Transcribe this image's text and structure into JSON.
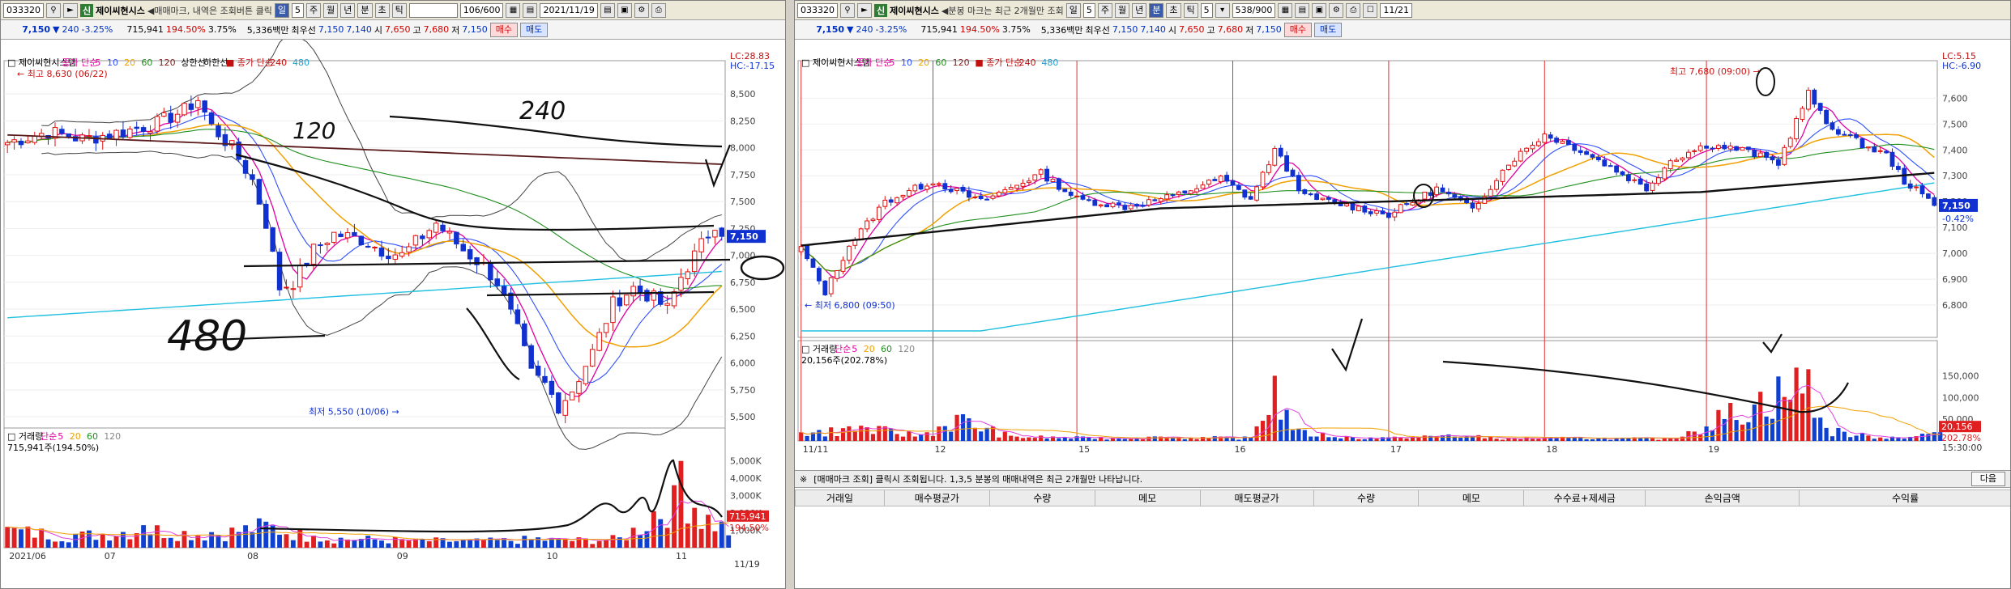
{
  "panel_left": {
    "toolbar": {
      "code": "033320",
      "badge": "신",
      "name": "제이씨현시스",
      "hint": "◀매매마크, 내역은 조회버튼 클릭",
      "period_d": "일",
      "period_num": "5",
      "periods": [
        "주",
        "월",
        "년",
        "분",
        "초",
        "틱"
      ],
      "count": "106/600",
      "date": "2021/11/19"
    },
    "quote": {
      "price": "7,150",
      "change_dir": "▼",
      "change": "240",
      "pct": "-3.25%",
      "volume": "715,941",
      "vol_ratio": "194.50%",
      "turnover": "3.75%",
      "amount": "5,336백만",
      "prev_label": "최우선",
      "bid": "7,150",
      "ask": "7,140",
      "open_l": "시",
      "open": "7,650",
      "high_l": "고",
      "high": "7,680",
      "low_l": "저",
      "low": "7,150",
      "buy": "매수",
      "sell": "매도"
    },
    "legend": {
      "name": "제이씨현시스템",
      "ma_label": "종가 단순",
      "p5": "5",
      "p10": "10",
      "p20": "20",
      "p60": "60",
      "p120": "120",
      "upper": "상한선",
      "lower": "하한선",
      "ma2_label": "종가 단순",
      "p240": "240",
      "p480": "480"
    },
    "corner": {
      "lc": "LC:28.83",
      "hc": "HC:-17.15"
    },
    "annot_high": "← 최고 8,630 (06/22)",
    "annot_low": "최저 5,550 (10/06) →",
    "hand": {
      "h240": "240",
      "h120": "120",
      "h480": "480"
    },
    "vol_legend": {
      "label": "거래량",
      "ma": "단순",
      "p5": "5",
      "p20": "20",
      "p60": "60",
      "p120": "120",
      "value": "715,941주(194.50%)"
    },
    "vol_tags": {
      "v": "715,941",
      "pct": "194.50%"
    },
    "price_tag": "7,150",
    "date_label": "11/19"
  },
  "panel_right": {
    "toolbar": {
      "code": "033320",
      "badge": "신",
      "name": "제이씨현시스",
      "hint": "◀분봉 마크는 최근 2개월만 조회",
      "period_d": "일",
      "period_num": "5",
      "periods": [
        "주",
        "월",
        "년",
        "분",
        "초",
        "틱"
      ],
      "period_num2": "5",
      "count": "538/900",
      "date": "11/21"
    },
    "quote": {
      "price": "7,150",
      "change_dir": "▼",
      "change": "240",
      "pct": "-3.25%",
      "volume": "715,941",
      "vol_ratio": "194.50%",
      "turnover": "3.75%",
      "amount": "5,336백만",
      "prev_label": "최우선",
      "bid": "7,150",
      "ask": "7,140",
      "open_l": "시",
      "open": "7,650",
      "high_l": "고",
      "high": "7,680",
      "low_l": "저",
      "low": "7,150",
      "buy": "매수",
      "sell": "매도"
    },
    "legend": {
      "name": "제이씨현시스템",
      "ma_label": "종가 단순",
      "p5": "5",
      "p10": "10",
      "p20": "20",
      "p60": "60",
      "p120": "120",
      "ma2_label": "종가 단순",
      "p240": "240",
      "p480": "480"
    },
    "corner": {
      "lc": "LC:5.15",
      "hc": "HC:-6.90"
    },
    "annot_high": "최고 7,680 (09:00) →",
    "annot_low": "← 최저 6,800 (09:50)",
    "vol_legend": {
      "label": "거래량",
      "ma": "단순",
      "p5": "5",
      "p20": "20",
      "p60": "60",
      "p120": "120",
      "value": "20,156주(202.78%)"
    },
    "vol_tags": {
      "v": "20,156",
      "pct": "202.78%"
    },
    "price_tag": "7,150",
    "price_pct": "-0.42%",
    "time_label": "15:30:00",
    "info_mark": "※",
    "info_text": "[매매마크 조회] 클릭시 조회됩니다. 1,3,5 분봉의 매매내역은 최근 2개월만 나타납니다.",
    "next_btn": "다음",
    "table_headers": [
      "거래일",
      "매수평균가",
      "수량",
      "메모",
      "매도평균가",
      "수량",
      "메모",
      "수수료+제세금",
      "손익금액",
      "수익률"
    ]
  },
  "chart_data": [
    {
      "type": "candlestick",
      "title": "제이씨현시스템",
      "timeframe": "daily",
      "x_ticks": [
        "2021/06",
        "07",
        "08",
        "09",
        "10",
        "11"
      ],
      "price_ticks": [
        5500,
        5750,
        6000,
        6250,
        6500,
        6750,
        7000,
        7250,
        7500,
        7750,
        8000,
        8250,
        8500
      ],
      "ylim": [
        5350,
        8750
      ],
      "volume_ticks": [
        "1,000K",
        "2,000K",
        "3,000K",
        "4,000K",
        "5,000K"
      ],
      "volume_ylim": [
        0,
        5500
      ],
      "annotations": {
        "high": 8630,
        "high_date": "06/22",
        "low": 5550,
        "low_date": "10/06"
      },
      "price_anchors": [
        [
          0,
          8050
        ],
        [
          6,
          8150
        ],
        [
          11,
          8080
        ],
        [
          17,
          8150
        ],
        [
          22,
          8230
        ],
        [
          26,
          8350
        ],
        [
          28,
          8450
        ],
        [
          30,
          8200
        ],
        [
          33,
          8000
        ],
        [
          36,
          7700
        ],
        [
          38,
          7300
        ],
        [
          40,
          6700
        ],
        [
          42,
          6750
        ],
        [
          45,
          7050
        ],
        [
          48,
          7200
        ],
        [
          52,
          7150
        ],
        [
          55,
          7050
        ],
        [
          58,
          7000
        ],
        [
          63,
          7300
        ],
        [
          67,
          7050
        ],
        [
          70,
          6900
        ],
        [
          72,
          6750
        ],
        [
          75,
          6300
        ],
        [
          77,
          5900
        ],
        [
          79,
          5800
        ],
        [
          81,
          5600
        ],
        [
          83,
          5750
        ],
        [
          86,
          6100
        ],
        [
          89,
          6550
        ],
        [
          92,
          6700
        ],
        [
          95,
          6600
        ],
        [
          97,
          6500
        ],
        [
          99,
          6800
        ],
        [
          102,
          7100
        ],
        [
          104,
          7300
        ],
        [
          106,
          7150
        ]
      ],
      "volume_anchors": [
        [
          0,
          1200
        ],
        [
          10,
          800
        ],
        [
          20,
          1300
        ],
        [
          30,
          900
        ],
        [
          38,
          1500
        ],
        [
          45,
          700
        ],
        [
          60,
          500
        ],
        [
          70,
          450
        ],
        [
          78,
          600
        ],
        [
          82,
          500
        ],
        [
          90,
          600
        ],
        [
          95,
          2100
        ],
        [
          98,
          3600
        ],
        [
          99,
          5000
        ],
        [
          101,
          2300
        ],
        [
          103,
          1900
        ],
        [
          105,
          1500
        ],
        [
          106,
          716
        ]
      ],
      "series_meta": {
        "count": 106
      }
    },
    {
      "type": "candlestick",
      "title": "제이씨현시스템",
      "timeframe": "5-minute",
      "x_ticks": [
        "11/11",
        "12",
        "15",
        "16",
        "17",
        "18",
        "19"
      ],
      "price_ticks": [
        6800,
        6900,
        7000,
        7100,
        7200,
        7300,
        7400,
        7500,
        7600
      ],
      "ylim": [
        6700,
        7720
      ],
      "volume_ticks": [
        "50,000",
        "100,000",
        "150,000"
      ],
      "volume_ylim": [
        0,
        175000
      ],
      "annotations": {
        "high": 7680,
        "high_time": "09:00",
        "low": 6800,
        "low_time": "09:50"
      },
      "price_anchors": [
        [
          0,
          7020
        ],
        [
          4,
          6850
        ],
        [
          8,
          7030
        ],
        [
          14,
          7200
        ],
        [
          22,
          7280
        ],
        [
          30,
          7200
        ],
        [
          40,
          7310
        ],
        [
          46,
          7210
        ],
        [
          54,
          7180
        ],
        [
          62,
          7220
        ],
        [
          70,
          7290
        ],
        [
          75,
          7210
        ],
        [
          79,
          7400
        ],
        [
          84,
          7220
        ],
        [
          90,
          7190
        ],
        [
          98,
          7150
        ],
        [
          106,
          7250
        ],
        [
          112,
          7170
        ],
        [
          118,
          7350
        ],
        [
          124,
          7460
        ],
        [
          130,
          7400
        ],
        [
          136,
          7320
        ],
        [
          141,
          7250
        ],
        [
          145,
          7360
        ],
        [
          151,
          7420
        ],
        [
          157,
          7400
        ],
        [
          163,
          7350
        ],
        [
          168,
          7620
        ],
        [
          171,
          7500
        ],
        [
          177,
          7420
        ],
        [
          181,
          7380
        ],
        [
          184,
          7280
        ],
        [
          190,
          7170
        ]
      ],
      "volume_anchors": [
        [
          0,
          20000
        ],
        [
          10,
          35000
        ],
        [
          20,
          15000
        ],
        [
          26,
          60000
        ],
        [
          35,
          12000
        ],
        [
          48,
          8000
        ],
        [
          60,
          10000
        ],
        [
          75,
          8000
        ],
        [
          79,
          150000
        ],
        [
          82,
          25000
        ],
        [
          92,
          9000
        ],
        [
          100,
          8000
        ],
        [
          108,
          15000
        ],
        [
          118,
          7000
        ],
        [
          130,
          8000
        ],
        [
          145,
          6000
        ],
        [
          168,
          165000
        ],
        [
          171,
          30000
        ],
        [
          180,
          8000
        ],
        [
          190,
          20156
        ]
      ],
      "series_meta": {
        "count": 190
      }
    }
  ]
}
